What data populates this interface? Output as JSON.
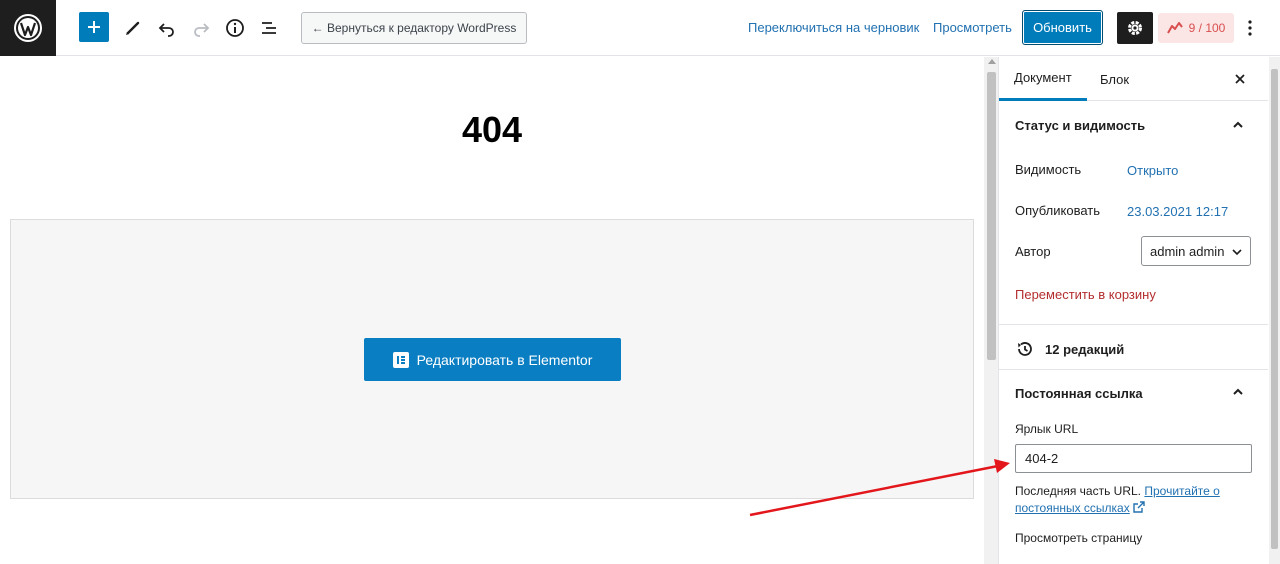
{
  "toolbar": {
    "back_label": "← Вернуться к редактору WordPress",
    "switch_draft_label": "Переключиться на черновик",
    "preview_label": "Просмотреть",
    "update_label": "Обновить",
    "score_label": "9 / 100"
  },
  "editor": {
    "page_title": "404",
    "elementor_button_label": "Редактировать в Elementor"
  },
  "sidebar": {
    "tabs": [
      {
        "label": "Документ",
        "active": true
      },
      {
        "label": "Блок",
        "active": false
      }
    ],
    "status_panel": {
      "title": "Статус и видимость",
      "visibility_label": "Видимость",
      "visibility_value": "Открыто",
      "publish_label": "Опубликовать",
      "publish_value": "23.03.2021 12:17",
      "author_label": "Автор",
      "author_value": "admin admin",
      "trash_label": "Переместить в корзину"
    },
    "revisions_label": "12 редакций",
    "permalink_panel": {
      "title": "Постоянная ссылка",
      "slug_label": "Ярлык URL",
      "slug_value": "404-2",
      "help_text": "Последняя часть URL.",
      "help_link": "Прочитайте о постоянных ссылках",
      "view_page_label": "Просмотреть страницу"
    }
  },
  "colors": {
    "accent": "#007cba",
    "dark": "#1e1e1e",
    "link": "#2271b1",
    "danger": "#b32d2e",
    "annotation_arrow": "#e3161b"
  }
}
